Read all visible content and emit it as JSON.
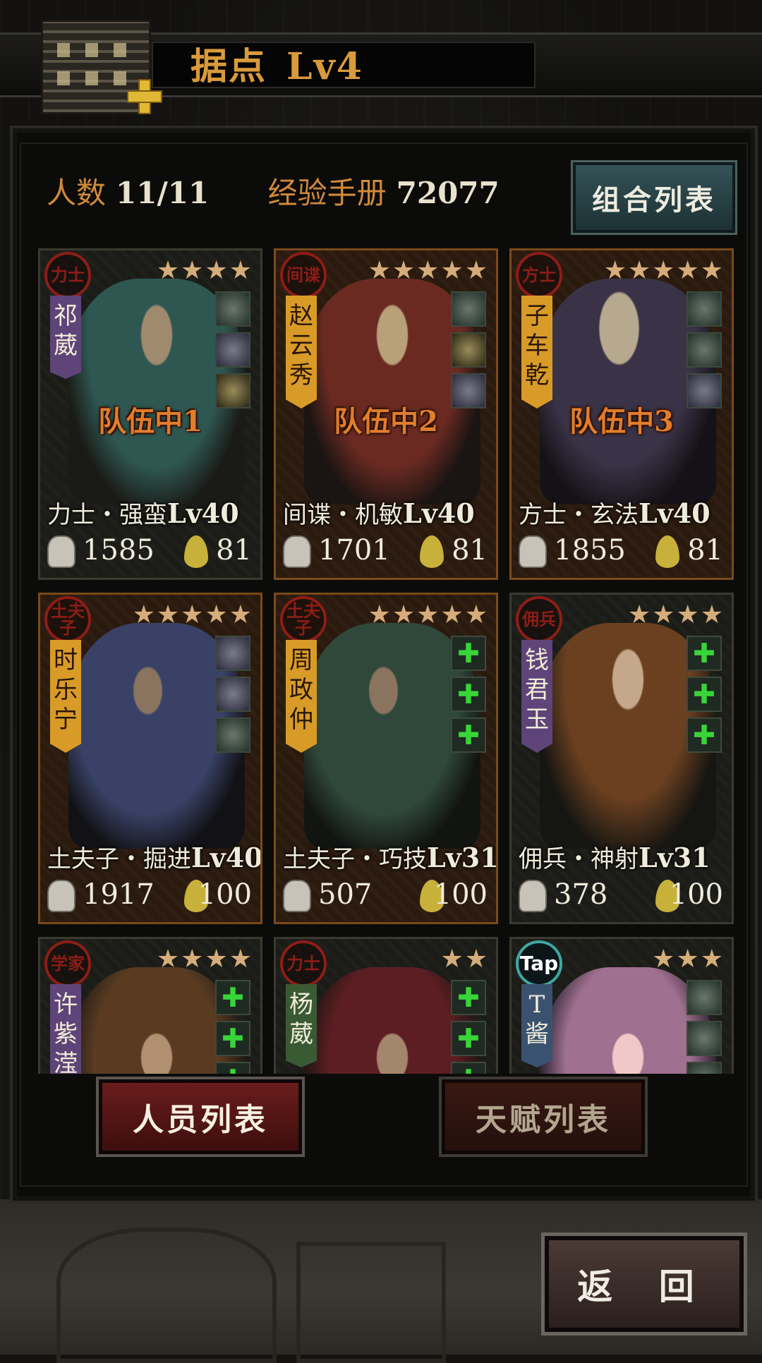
{
  "header": {
    "title": "据点",
    "level": "Lv4"
  },
  "stats": {
    "count_label": "人数",
    "count_value": "11/11",
    "exp_label": "经验手册",
    "exp_value": "72077"
  },
  "buttons": {
    "combo_list": "组合列表",
    "people_list": "人员列表",
    "talent_list": "天赋列表",
    "back": "返 回"
  },
  "characters": [
    {
      "seal": "力士",
      "name": "祁葳",
      "stars": "★★★★",
      "team": "队伍中1",
      "class": "力士・强蛮",
      "level": "Lv40",
      "power": "1585",
      "stamina": "81"
    },
    {
      "seal": "间谍",
      "name": "赵云秀",
      "stars": "★★★★★",
      "team": "队伍中2",
      "class": "间谍・机敏",
      "level": "Lv40",
      "power": "1701",
      "stamina": "81"
    },
    {
      "seal": "方士",
      "name": "子车乾",
      "stars": "★★★★★",
      "team": "队伍中3",
      "class": "方士・玄法",
      "level": "Lv40",
      "power": "1855",
      "stamina": "81"
    },
    {
      "seal": "土夫子",
      "name": "时乐宁",
      "stars": "★★★★★",
      "team": "",
      "class": "土夫子・掘进",
      "level": "Lv40",
      "power": "1917",
      "stamina": "100"
    },
    {
      "seal": "土夫子",
      "name": "周政仲",
      "stars": "★★★★★",
      "team": "",
      "class": "土夫子・巧技",
      "level": "Lv31",
      "power": "507",
      "stamina": "100"
    },
    {
      "seal": "佣兵",
      "name": "钱君玉",
      "stars": "★★★★",
      "team": "",
      "class": "佣兵・神射",
      "level": "Lv31",
      "power": "378",
      "stamina": "100"
    },
    {
      "seal": "学家",
      "name": "许紫滢",
      "stars": "★★★★",
      "team": "",
      "class": "",
      "level": "",
      "power": "",
      "stamina": ""
    },
    {
      "seal": "力士",
      "name": "杨葳",
      "stars": "★★",
      "team": "",
      "class": "",
      "level": "",
      "power": "",
      "stamina": ""
    },
    {
      "seal": "Tap",
      "name": "T酱",
      "stars": "★★★",
      "team": "",
      "class": "",
      "level": "",
      "power": "",
      "stamina": ""
    }
  ],
  "slot_plus": "✚",
  "colors": {
    "accent_orange": "#d0893b",
    "seal_red": "#8d1d16",
    "plus_green": "#39d439"
  }
}
